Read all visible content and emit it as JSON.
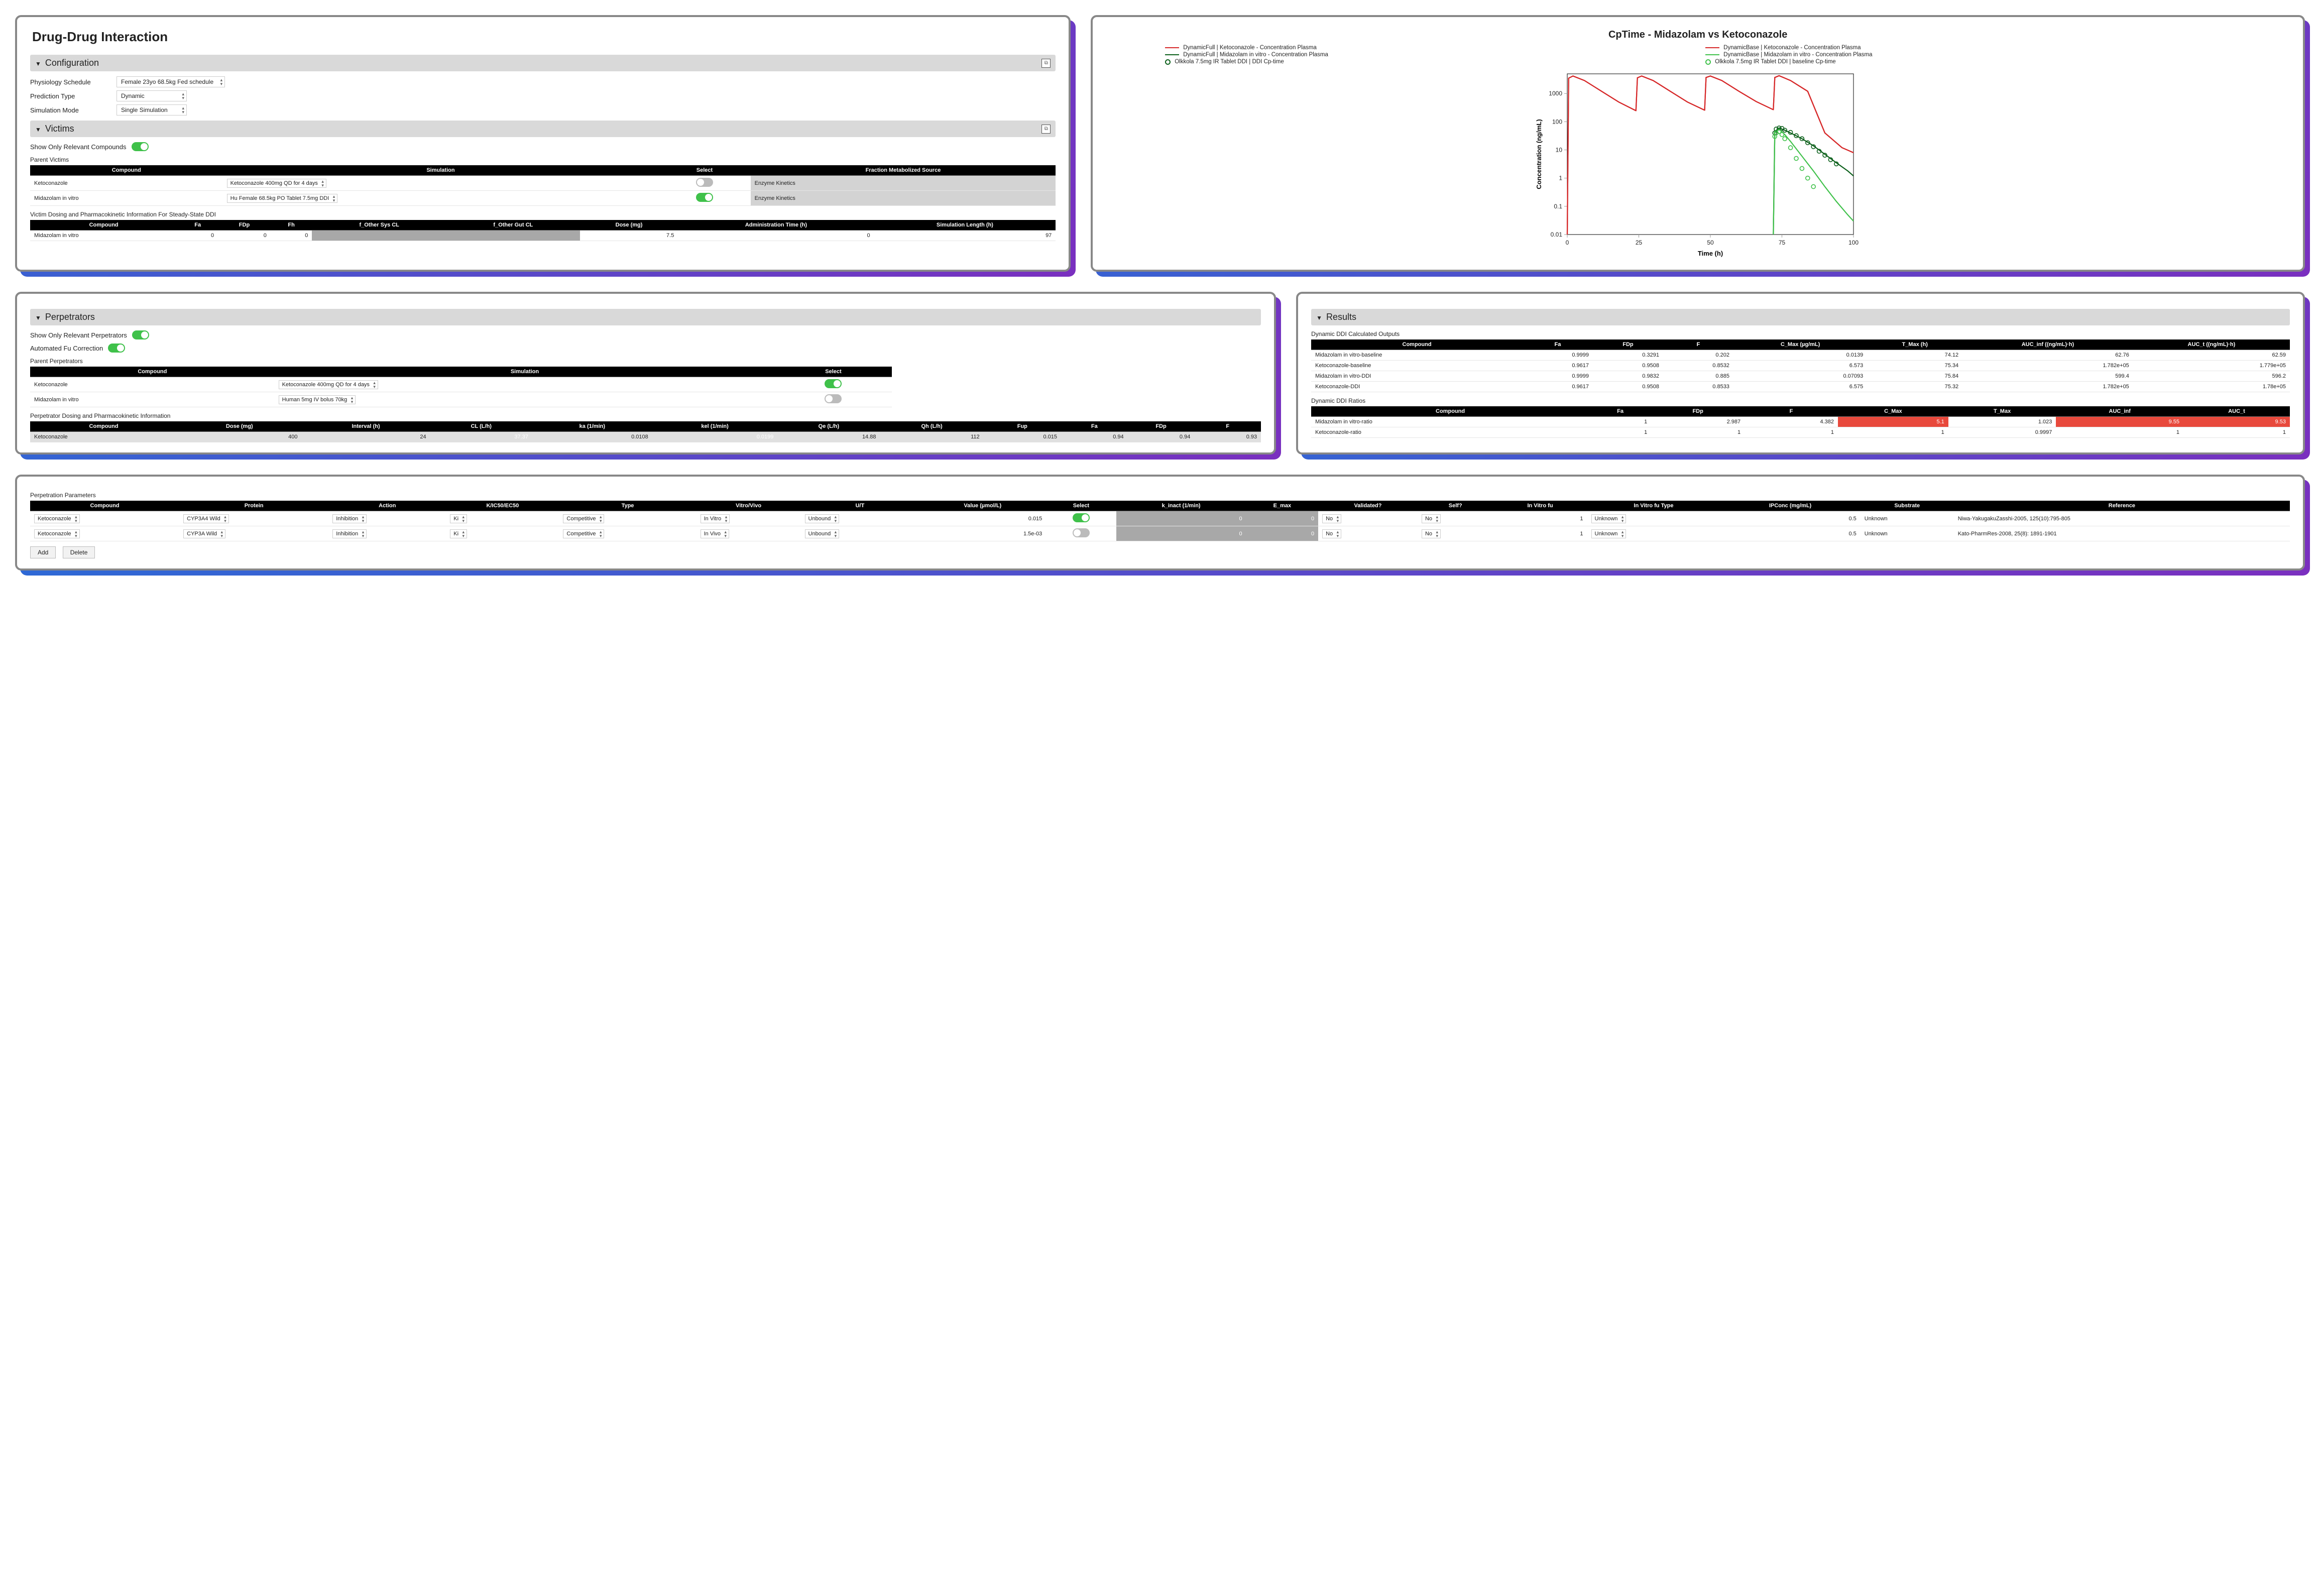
{
  "page_title": "Drug-Drug Interaction",
  "configuration": {
    "header": "Configuration",
    "rows": [
      {
        "label": "Physiology Schedule",
        "value": "Female 23yo 68.5kg Fed schedule"
      },
      {
        "label": "Prediction Type",
        "value": "Dynamic"
      },
      {
        "label": "Simulation Mode",
        "value": "Single Simulation"
      }
    ]
  },
  "victims": {
    "header": "Victims",
    "show_relevant_label": "Show Only Relevant Compounds",
    "parent_title": "Parent Victims",
    "headers": [
      "Compound",
      "Simulation",
      "Select",
      "Fraction Metabolized Source"
    ],
    "rows": [
      {
        "compound": "Ketoconazole",
        "simulation": "Ketoconazole 400mg QD for 4 days",
        "selected": false,
        "fm_source": "Enzyme Kinetics"
      },
      {
        "compound": "Midazolam in vitro",
        "simulation": "Hu Female 68.5kg PO Tablet 7.5mg DDI",
        "selected": true,
        "fm_source": "Enzyme Kinetics"
      }
    ],
    "dosing_title": "Victim Dosing and Pharmacokinetic Information For Steady-State DDI",
    "dosing_headers": [
      "Compound",
      "Fa",
      "FDp",
      "Fh",
      "f_Other Sys CL",
      "f_Other Gut CL",
      "Dose (mg)",
      "Administration Time (h)",
      "Simulation Length (h)"
    ],
    "dosing_row": {
      "compound": "Midazolam in vitro",
      "fa": "0",
      "fdp": "0",
      "fh": "0",
      "fosys": "",
      "fogut": "",
      "dose": "7.5",
      "admin_t": "0",
      "sim_len": "97"
    }
  },
  "perpetrators": {
    "header": "Perpetrators",
    "show_relevant_label": "Show Only Relevant Perpetrators",
    "auto_fu_label": "Automated Fu Correction",
    "parent_title": "Parent Perpetrators",
    "headers": [
      "Compound",
      "Simulation",
      "Select"
    ],
    "rows": [
      {
        "compound": "Ketoconazole",
        "simulation": "Ketoconazole 400mg QD for 4 days",
        "selected": true
      },
      {
        "compound": "Midazolam in vitro",
        "simulation": "Human 5mg IV bolus 70kg",
        "selected": false
      }
    ],
    "pk_title": "Perpetrator Dosing and Pharmacokinetic Information",
    "pk_headers": [
      "Compound",
      "Dose (mg)",
      "Interval (h)",
      "CL (L/h)",
      "ka (1/min)",
      "kel (1/min)",
      "Qe (L/h)",
      "Qh (L/h)",
      "Fup",
      "Fa",
      "FDp",
      "F"
    ],
    "pk_row": {
      "compound": "Ketoconazole",
      "dose": "400",
      "interval": "24",
      "cl": "37.37",
      "ka": "0.0108",
      "kel": "0.0199",
      "qe": "14.88",
      "qh": "112",
      "fup": "0.015",
      "fa": "0.94",
      "fdp": "0.94",
      "f": "0.93"
    }
  },
  "perp_params": {
    "title": "Perpetration Parameters",
    "headers": [
      "Compound",
      "Protein",
      "Action",
      "K/IC50/EC50",
      "Type",
      "Vitro/Vivo",
      "U/T",
      "Value (µmol/L)",
      "Select",
      "k_inact (1/min)",
      "E_max",
      "Validated?",
      "Self?",
      "In Vitro fu",
      "In Vitro fu Type",
      "IPConc (mg/mL)",
      "Substrate",
      "Reference"
    ],
    "rows": [
      {
        "compound": "Ketoconazole",
        "protein": "CYP3A4 Wild",
        "action": "Inhibition",
        "k": "Ki",
        "type": "Competitive",
        "vv": "In Vitro",
        "ut": "Unbound",
        "value": "0.015",
        "selected": true,
        "kinact": "0",
        "emax": "0",
        "validated": "No",
        "self": "No",
        "iv_fu": "1",
        "iv_fu_type": "Unknown",
        "ipconc": "0.5",
        "substrate": "Unknown",
        "ref": "Niwa-YakugakuZasshi-2005, 125(10):795-805"
      },
      {
        "compound": "Ketoconazole",
        "protein": "CYP3A Wild",
        "action": "Inhibition",
        "k": "Ki",
        "type": "Competitive",
        "vv": "In Vivo",
        "ut": "Unbound",
        "value": "1.5e-03",
        "selected": false,
        "kinact": "0",
        "emax": "0",
        "validated": "No",
        "self": "No",
        "iv_fu": "1",
        "iv_fu_type": "Unknown",
        "ipconc": "0.5",
        "substrate": "Unknown",
        "ref": "Kato-PharmRes-2008, 25(8): 1891-1901"
      }
    ],
    "add_btn": "Add",
    "del_btn": "Delete"
  },
  "results": {
    "header": "Results",
    "calc_title": "Dynamic DDI Calculated Outputs",
    "calc_headers": [
      "Compound",
      "Fa",
      "FDp",
      "F",
      "C_Max (µg/mL)",
      "T_Max (h)",
      "AUC_inf ((ng/mL)·h)",
      "AUC_t ((ng/mL)·h)"
    ],
    "calc_rows": [
      {
        "c": "Midazolam in vitro-baseline",
        "fa": "0.9999",
        "fdp": "0.3291",
        "f": "0.202",
        "cmax": "0.0139",
        "tmax": "74.12",
        "aucinf": "62.76",
        "auct": "62.59"
      },
      {
        "c": "Ketoconazole-baseline",
        "fa": "0.9617",
        "fdp": "0.9508",
        "f": "0.8532",
        "cmax": "6.573",
        "tmax": "75.34",
        "aucinf": "1.782e+05",
        "auct": "1.779e+05"
      },
      {
        "c": "Midazolam in vitro-DDI",
        "fa": "0.9999",
        "fdp": "0.9832",
        "f": "0.885",
        "cmax": "0.07093",
        "tmax": "75.84",
        "aucinf": "599.4",
        "auct": "596.2"
      },
      {
        "c": "Ketoconazole-DDI",
        "fa": "0.9617",
        "fdp": "0.9508",
        "f": "0.8533",
        "cmax": "6.575",
        "tmax": "75.32",
        "aucinf": "1.782e+05",
        "auct": "1.78e+05"
      }
    ],
    "ratio_title": "Dynamic DDI Ratios",
    "ratio_headers": [
      "Compound",
      "Fa",
      "FDp",
      "F",
      "C_Max",
      "T_Max",
      "AUC_inf",
      "AUC_t"
    ],
    "ratio_rows": [
      {
        "c": "Midazolam in vitro-ratio",
        "fa": "1",
        "fdp": "2.987",
        "f": "4.382",
        "cmax": "5.1",
        "tmax": "1.023",
        "aucinf": "9.55",
        "auct": "9.53",
        "hi": [
          "cmax",
          "aucinf",
          "auct"
        ]
      },
      {
        "c": "Ketoconazole-ratio",
        "fa": "1",
        "fdp": "1",
        "f": "1",
        "cmax": "1",
        "tmax": "0.9997",
        "aucinf": "1",
        "auct": "1",
        "hi": []
      }
    ]
  },
  "chart_data": {
    "type": "line",
    "title": "CpTime - Midazolam vs Ketoconazole",
    "xlabel": "Time (h)",
    "ylabel": "Concentration (ng/mL)",
    "xlim": [
      0,
      100
    ],
    "ylim": [
      0.01,
      5000
    ],
    "yscale": "log",
    "x_ticks": [
      0,
      25,
      50,
      75,
      100
    ],
    "y_ticks": [
      0.01,
      0.1,
      1,
      10,
      100,
      1000
    ],
    "series": [
      {
        "name": "DynamicFull | Ketoconazole - Concentration Plasma",
        "color": "#d62728",
        "style": "solid",
        "x": [
          0,
          0.5,
          2,
          6,
          12,
          18,
          23.9,
          24,
          24.5,
          26,
          30,
          36,
          42,
          47.9,
          48,
          48.5,
          50,
          54,
          60,
          66,
          71.9,
          72,
          72.5,
          74,
          78,
          84,
          90,
          96,
          100
        ],
        "y": [
          0.01,
          3500,
          4200,
          2900,
          1200,
          500,
          250,
          250,
          3600,
          4200,
          2900,
          1200,
          500,
          260,
          260,
          3700,
          4200,
          2900,
          1200,
          520,
          270,
          270,
          3700,
          4300,
          2900,
          1200,
          40,
          12,
          8
        ]
      },
      {
        "name": "DynamicBase | Ketoconazole - Concentration Plasma",
        "color": "#d62728",
        "style": "solid",
        "x": [
          0,
          0.5,
          2,
          6,
          12,
          18,
          23.9,
          24,
          24.5,
          26,
          30,
          36,
          42,
          47.9,
          48,
          48.5,
          50,
          54,
          60,
          66,
          71.9,
          72,
          72.5,
          74,
          78,
          84,
          90,
          96,
          100
        ],
        "y": [
          0.01,
          3500,
          4200,
          2900,
          1200,
          500,
          250,
          250,
          3600,
          4200,
          2900,
          1200,
          500,
          260,
          260,
          3700,
          4200,
          2900,
          1200,
          520,
          270,
          270,
          3700,
          4300,
          2900,
          1200,
          40,
          12,
          8
        ]
      },
      {
        "name": "DynamicFull | Midazolam in vitro - Concentration Plasma",
        "color": "#0b5f1a",
        "style": "solid",
        "x": [
          72,
          72.5,
          74,
          76,
          78,
          82,
          86,
          90,
          94,
          98,
          100
        ],
        "y": [
          0.01,
          45,
          60,
          50,
          40,
          25,
          14,
          7,
          3.5,
          1.8,
          1.2
        ]
      },
      {
        "name": "DynamicBase | Midazolam in vitro - Concentration Plasma",
        "color": "#3fc14a",
        "style": "solid",
        "x": [
          72,
          72.5,
          74,
          76,
          78,
          82,
          86,
          90,
          94,
          98,
          100
        ],
        "y": [
          0.01,
          40,
          55,
          35,
          20,
          6,
          1.8,
          0.5,
          0.15,
          0.05,
          0.03
        ]
      }
    ],
    "scatter": [
      {
        "name": "Olkkola 7.5mg IR Tablet DDI | DDI Cp-time",
        "marker": "open-circle",
        "color": "#0b5f1a",
        "x": [
          72.5,
          73,
          74,
          75,
          76,
          78,
          80,
          82,
          84,
          86,
          88,
          90,
          92,
          94
        ],
        "y": [
          40,
          55,
          60,
          58,
          50,
          42,
          32,
          25,
          18,
          13,
          9,
          6.5,
          4.5,
          3.2
        ]
      },
      {
        "name": "Olkkola 7.5mg IR Tablet DDI | baseline Cp-time",
        "marker": "open-circle",
        "color": "#3fc14a",
        "x": [
          72.5,
          73,
          74,
          75,
          76,
          78,
          80,
          82,
          84,
          86
        ],
        "y": [
          30,
          40,
          45,
          35,
          25,
          12,
          5,
          2.2,
          1.0,
          0.5
        ]
      }
    ]
  }
}
